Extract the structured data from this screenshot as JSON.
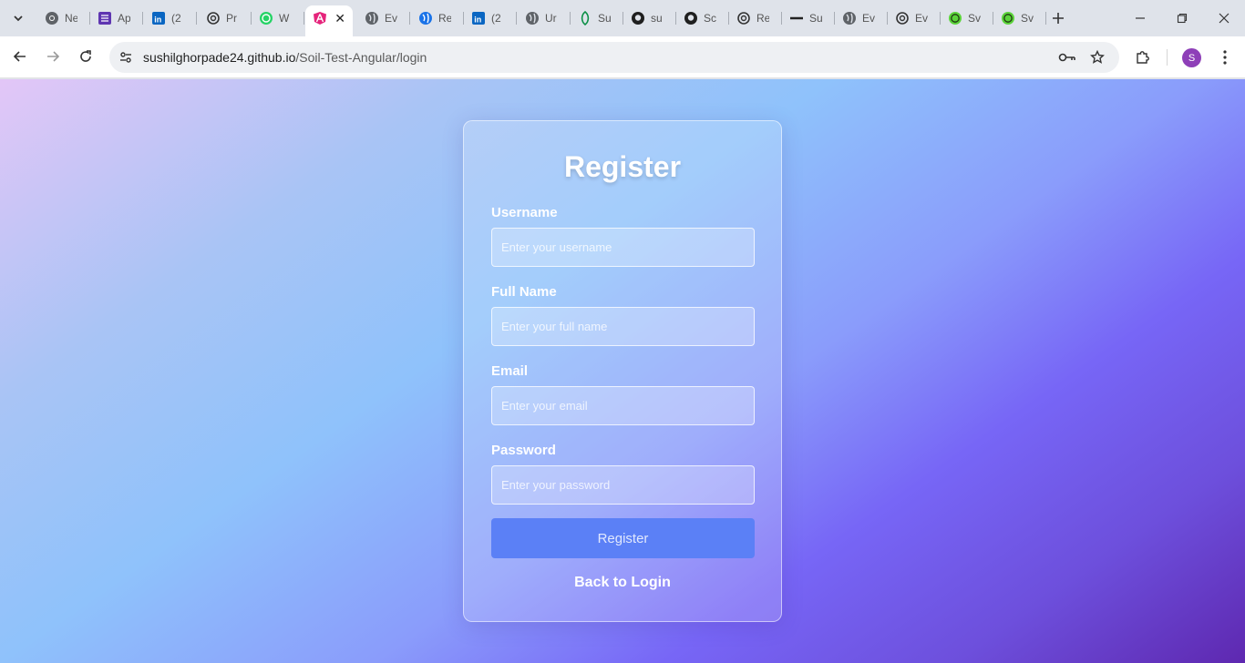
{
  "browser": {
    "tabs": [
      {
        "icon": "chrome-icon",
        "title": "Ne"
      },
      {
        "icon": "list-icon",
        "title": "Ap"
      },
      {
        "icon": "linkedin-icon",
        "title": "(2"
      },
      {
        "icon": "openai-icon",
        "title": "Pr"
      },
      {
        "icon": "whatsapp-icon",
        "title": "W"
      },
      {
        "icon": "angular-icon",
        "title": "",
        "active": true
      },
      {
        "icon": "globe-icon",
        "title": "Ev"
      },
      {
        "icon": "blue-globe-icon",
        "title": "Re"
      },
      {
        "icon": "linkedin-icon",
        "title": "(2"
      },
      {
        "icon": "globe-icon",
        "title": "Ur"
      },
      {
        "icon": "leaf-icon",
        "title": "Su"
      },
      {
        "icon": "github-icon",
        "title": "su"
      },
      {
        "icon": "github-icon",
        "title": "Sc"
      },
      {
        "icon": "openai-icon",
        "title": "Re"
      },
      {
        "icon": "line-icon",
        "title": "Su"
      },
      {
        "icon": "globe-icon",
        "title": "Ev"
      },
      {
        "icon": "openai-icon",
        "title": "Ev"
      },
      {
        "icon": "green-logo-icon",
        "title": "Sv"
      },
      {
        "icon": "green-logo-icon",
        "title": "Sv"
      }
    ],
    "url_domain": "sushilghorpade24.github.io",
    "url_path": "/Soil-Test-Angular/login",
    "profile_initial": "S"
  },
  "form": {
    "title": "Register",
    "username_label": "Username",
    "username_placeholder": "Enter your username",
    "fullname_label": "Full Name",
    "fullname_placeholder": "Enter your full name",
    "email_label": "Email",
    "email_placeholder": "Enter your email",
    "password_label": "Password",
    "password_placeholder": "Enter your password",
    "submit_label": "Register",
    "back_link": "Back to Login"
  },
  "colors": {
    "button": "#5b80f6",
    "avatar": "#8e3fb8"
  }
}
